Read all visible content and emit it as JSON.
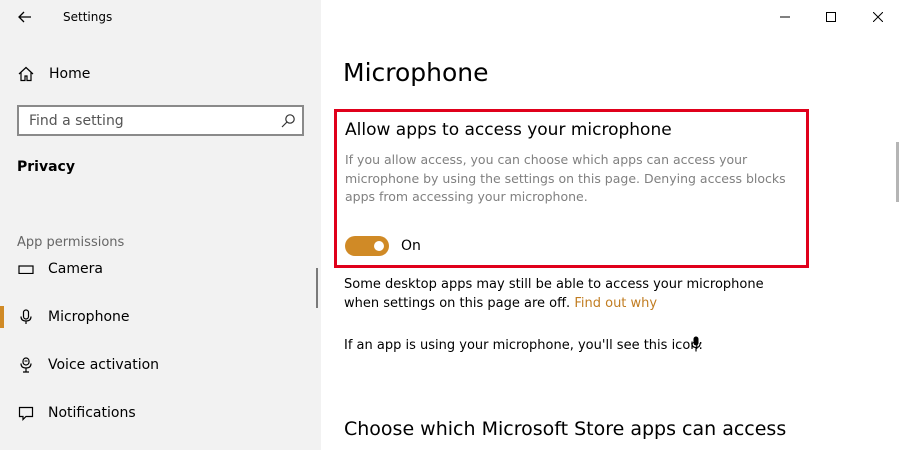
{
  "window": {
    "app_title": "Settings",
    "controls": [
      "minimize",
      "maximize",
      "close"
    ]
  },
  "sidebar": {
    "home_label": "Home",
    "search_placeholder": "Find a setting",
    "category": "Privacy",
    "section_label": "App permissions",
    "items": [
      {
        "label": "Camera",
        "icon": "camera-icon",
        "active": false
      },
      {
        "label": "Microphone",
        "icon": "microphone-icon",
        "active": true
      },
      {
        "label": "Voice activation",
        "icon": "voice-activation-icon",
        "active": false
      },
      {
        "label": "Notifications",
        "icon": "notifications-icon",
        "active": false
      }
    ]
  },
  "main": {
    "page_title": "Microphone",
    "allow_section": {
      "heading": "Allow apps to access your microphone",
      "description": "If you allow access, you can choose which apps can access your microphone by using the settings on this page. Denying access blocks apps from accessing your microphone.",
      "toggle_state": "On"
    },
    "note_text": "Some desktop apps may still be able to access your microphone when settings on this page are off.",
    "note_link": "Find out why",
    "icon_note": "If an app is using your microphone, you'll see this icon:",
    "choose_heading": "Choose which Microsoft Store apps can access"
  },
  "colors": {
    "accent": "#d08a26",
    "link": "#c17d22",
    "highlight_border": "#e0001b",
    "sidebar_bg": "#f2f2f2"
  }
}
